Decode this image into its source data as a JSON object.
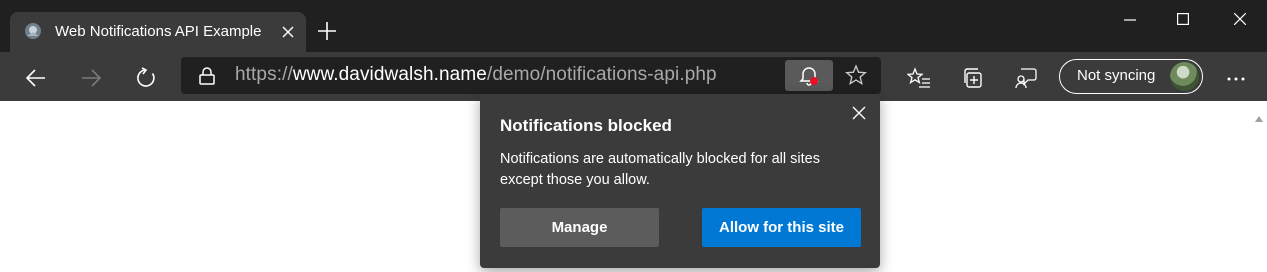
{
  "window": {
    "controls": [
      "minimize-icon",
      "maximize-icon",
      "close-icon"
    ]
  },
  "tab": {
    "title": "Web Notifications API Example",
    "favicon": "page-favicon-icon"
  },
  "toolbar": {
    "url_scheme": "https://",
    "url_host": "www.davidwalsh.name",
    "url_path": "/demo/notifications-api.php",
    "profile_label": "Not syncing"
  },
  "popup": {
    "title": "Notifications blocked",
    "body": "Notifications are automatically blocked for all sites except those you allow.",
    "manage_label": "Manage",
    "allow_label": "Allow for this site"
  },
  "colors": {
    "titlebar": "#202020",
    "toolbar": "#3b3b3b",
    "accent": "#0078d4",
    "notification_dot": "#e81123"
  }
}
